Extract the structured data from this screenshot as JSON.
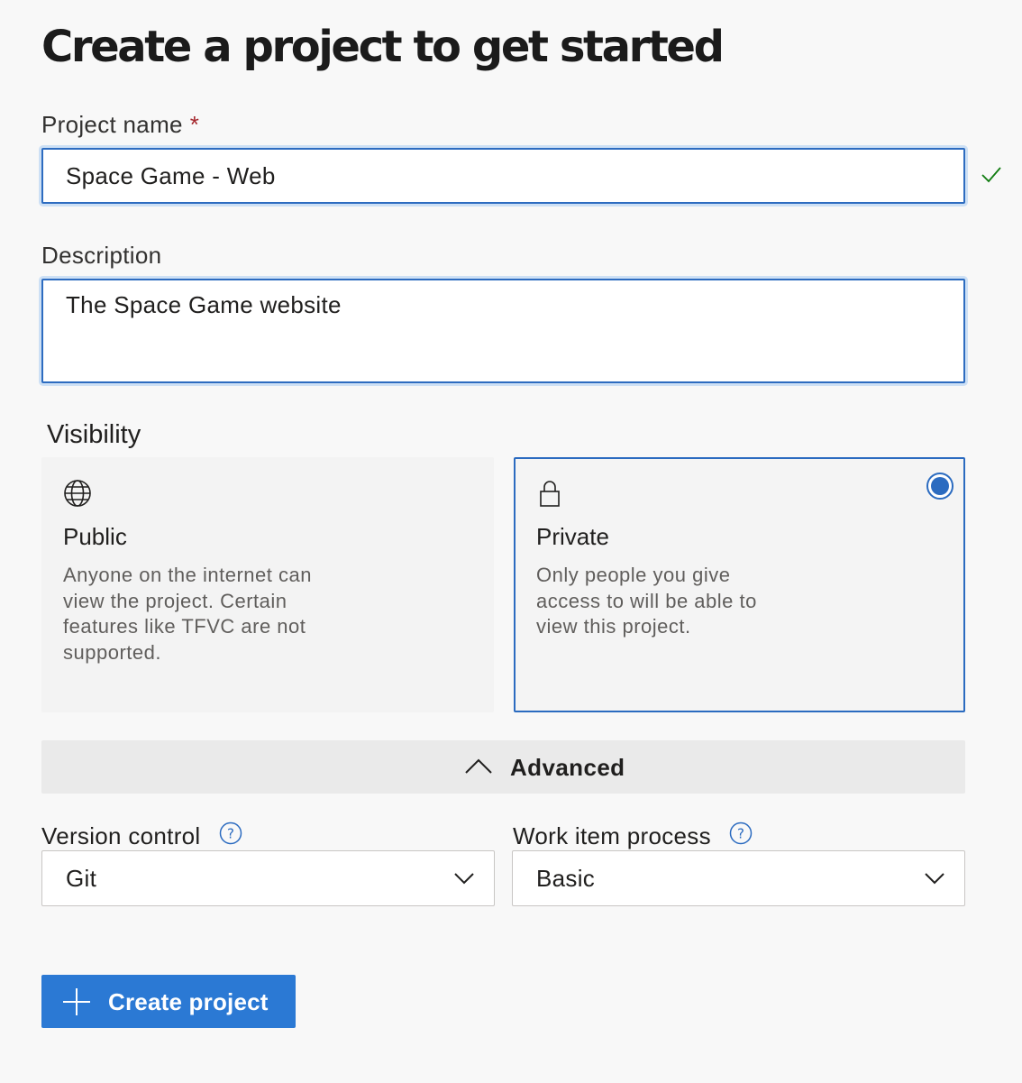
{
  "header": {
    "title": "Create a project to get started"
  },
  "form": {
    "project_name": {
      "label": "Project name",
      "required_mark": "*",
      "value": "Space Game - Web",
      "valid": true
    },
    "description": {
      "label": "Description",
      "value": "The Space Game website"
    },
    "visibility": {
      "label": "Visibility",
      "selected": "private",
      "options": [
        {
          "id": "public",
          "icon": "globe-icon",
          "title": "Public",
          "description": "Anyone on the internet can view the project. Certain features like TFVC are not supported."
        },
        {
          "id": "private",
          "icon": "lock-icon",
          "title": "Private",
          "description": "Only people you give access to will be able to view this project."
        }
      ]
    },
    "advanced": {
      "label": "Advanced",
      "expanded": true
    },
    "version_control": {
      "label": "Version control",
      "value": "Git"
    },
    "work_item_process": {
      "label": "Work item process",
      "value": "Basic"
    }
  },
  "actions": {
    "create_label": "Create project"
  },
  "colors": {
    "accent": "#2b79d4",
    "focus_border": "#2d6cc0",
    "required": "#a4262c",
    "valid": "#107c10"
  }
}
